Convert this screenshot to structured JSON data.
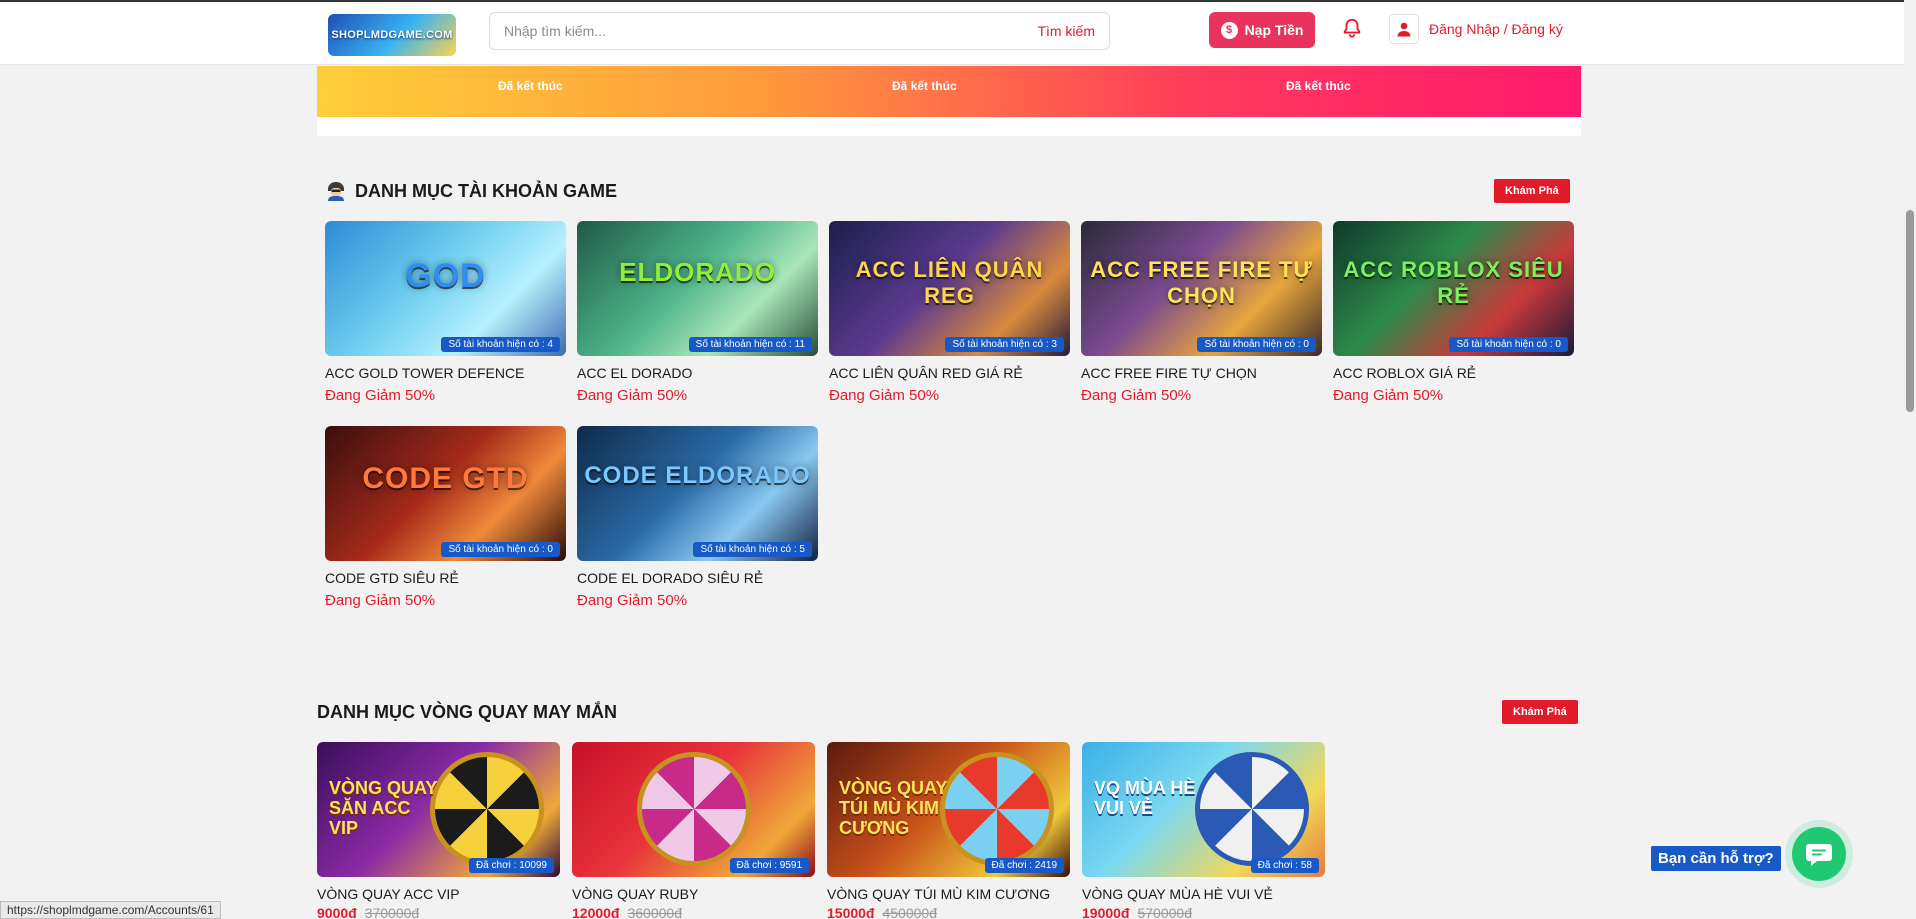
{
  "header": {
    "logo_text": "SHOPLMDGAME.COM",
    "search_placeholder": "Nhập tìm kiếm...",
    "search_button": "Tìm kiếm",
    "nap_tien": "Nạp Tiền",
    "coin_symbol": "$",
    "login": "Đăng Nhập / Đăng ký"
  },
  "banner": {
    "items": [
      "Đã kết thúc",
      "Đã kết thúc",
      "Đã kết thúc"
    ]
  },
  "accounts": {
    "title": "DANH MỤC TÀI KHOẢN GAME",
    "icon": "hacker-icon",
    "explore": "Khám Phá",
    "items": [
      {
        "art": "GOD",
        "badge": "Số tài khoản hiện có : 4",
        "name": "ACC GOLD TOWER DEFENCE",
        "sale": "Đang Giảm 50%"
      },
      {
        "art": "ELDORADO",
        "badge": "Số tài khoản hiện có : 11",
        "name": "ACC EL DORADO",
        "sale": "Đang Giảm 50%"
      },
      {
        "art": "ACC LIÊN QUÂN REG",
        "badge": "Số tài khoản hiện có : 3",
        "name": "ACC LIÊN QUÂN RED GIÁ RẺ",
        "sale": "Đang Giảm 50%"
      },
      {
        "art": "ACC FREE FIRE TỰ CHỌN",
        "badge": "Số tài khoản hiện có : 0",
        "name": "ACC FREE FIRE TỰ CHỌN",
        "sale": "Đang Giảm 50%"
      },
      {
        "art": "ACC ROBLOX SIÊU RẺ",
        "badge": "Số tài khoản hiện có : 0",
        "name": "ACC ROBLOX GIÁ RẺ",
        "sale": "Đang Giảm 50%"
      },
      {
        "art": "CODE GTD",
        "badge": "Số tài khoản hiện có : 0",
        "name": "CODE GTD SIÊU RẺ",
        "sale": "Đang Giảm 50%"
      },
      {
        "art": "CODE ELDORADO",
        "badge": "Số tài khoản hiện có : 5",
        "name": "CODE EL DORADO SIÊU RẺ",
        "sale": "Đang Giảm 50%"
      }
    ]
  },
  "wheels": {
    "title": "DANH MỤC VÒNG QUAY MAY MẮN",
    "explore": "Khám Phá",
    "items": [
      {
        "art": "VÒNG QUAY SĂN ACC VIP",
        "badge": "Đã chơi : 10099",
        "name": "VÒNG QUAY ACC VIP",
        "price": "9000đ",
        "old_price": "370000đ"
      },
      {
        "art": "",
        "badge": "Đã chơi : 9591",
        "name": "VÒNG QUAY RUBY",
        "price": "12000đ",
        "old_price": "360000đ"
      },
      {
        "art": "VÒNG QUAY TÚI MÙ KIM CƯƠNG",
        "badge": "Đã chơi : 2419",
        "name": "VÒNG QUAY TÚI MÙ KIM CƯƠNG",
        "price": "15000đ",
        "old_price": "450000đ"
      },
      {
        "art": "VQ MÙA HÈ VUI VẺ",
        "badge": "Đã chơi : 58",
        "name": "VÒNG QUAY MÙA HÈ VUI VẺ",
        "price": "19000đ",
        "old_price": "570000đ"
      }
    ]
  },
  "support": {
    "help_text": "Bạn cần hỗ trợ?"
  },
  "status_url": "https://shoplmdgame.com/Accounts/61",
  "colors": {
    "accent_red": "#e21b2b",
    "nap_pink": "#e8345c",
    "badge_blue": "#1759c7",
    "chat_green": "#21c873"
  }
}
